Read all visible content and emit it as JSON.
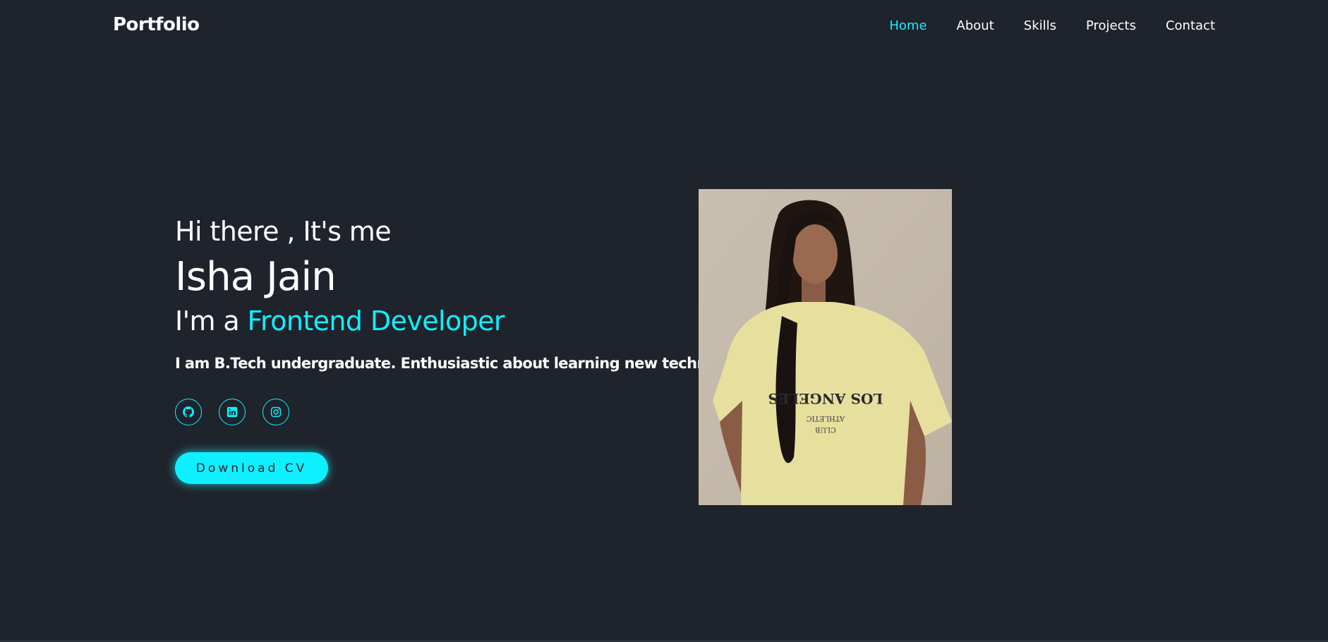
{
  "header": {
    "logo": "Portfolio",
    "nav": [
      {
        "label": "Home",
        "active": true
      },
      {
        "label": "About",
        "active": false
      },
      {
        "label": "Skills",
        "active": false
      },
      {
        "label": "Projects",
        "active": false
      },
      {
        "label": "Contact",
        "active": false
      }
    ]
  },
  "hero": {
    "greeting": "Hi there , It's me",
    "name": "Isha Jain",
    "role_prefix": "I'm a ",
    "role_accent": "Frontend Developer",
    "description": "I am B.Tech undergraduate. Enthusiastic about learning new technology.",
    "socials": [
      {
        "icon": "github-icon"
      },
      {
        "icon": "linkedin-icon"
      },
      {
        "icon": "instagram-icon"
      }
    ],
    "cv_button": "Download CV"
  },
  "photo": {
    "shirt_text_line1": "LOS ANGELES",
    "shirt_text_line2": "ATHLETIC",
    "shirt_text_line3": "CLUB"
  },
  "colors": {
    "background": "#1f232c",
    "accent": "#0ef0ff",
    "text": "#ffffff"
  }
}
